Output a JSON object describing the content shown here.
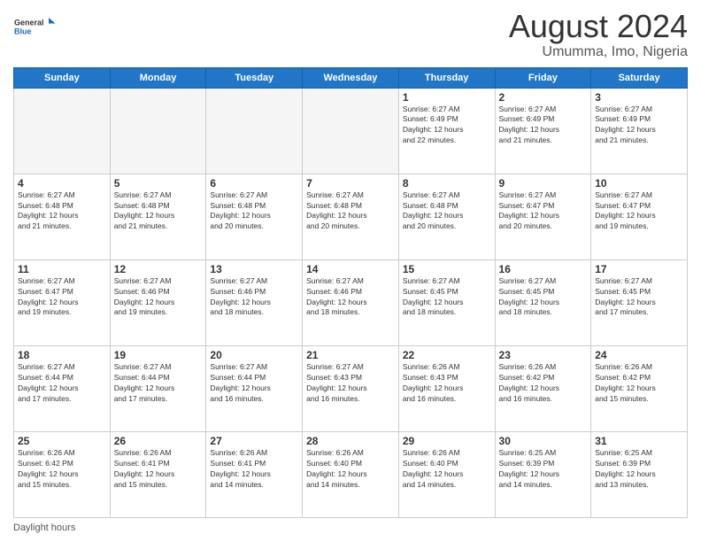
{
  "logo": {
    "line1": "General",
    "line2": "Blue"
  },
  "header": {
    "month_year": "August 2024",
    "location": "Umumma, Imo, Nigeria"
  },
  "days_of_week": [
    "Sunday",
    "Monday",
    "Tuesday",
    "Wednesday",
    "Thursday",
    "Friday",
    "Saturday"
  ],
  "footer": {
    "daylight_label": "Daylight hours"
  },
  "weeks": [
    {
      "days": [
        {
          "num": "",
          "info": ""
        },
        {
          "num": "",
          "info": ""
        },
        {
          "num": "",
          "info": ""
        },
        {
          "num": "",
          "info": ""
        },
        {
          "num": "1",
          "info": "Sunrise: 6:27 AM\nSunset: 6:49 PM\nDaylight: 12 hours\nand 22 minutes."
        },
        {
          "num": "2",
          "info": "Sunrise: 6:27 AM\nSunset: 6:49 PM\nDaylight: 12 hours\nand 21 minutes."
        },
        {
          "num": "3",
          "info": "Sunrise: 6:27 AM\nSunset: 6:49 PM\nDaylight: 12 hours\nand 21 minutes."
        }
      ]
    },
    {
      "days": [
        {
          "num": "4",
          "info": "Sunrise: 6:27 AM\nSunset: 6:48 PM\nDaylight: 12 hours\nand 21 minutes."
        },
        {
          "num": "5",
          "info": "Sunrise: 6:27 AM\nSunset: 6:48 PM\nDaylight: 12 hours\nand 21 minutes."
        },
        {
          "num": "6",
          "info": "Sunrise: 6:27 AM\nSunset: 6:48 PM\nDaylight: 12 hours\nand 20 minutes."
        },
        {
          "num": "7",
          "info": "Sunrise: 6:27 AM\nSunset: 6:48 PM\nDaylight: 12 hours\nand 20 minutes."
        },
        {
          "num": "8",
          "info": "Sunrise: 6:27 AM\nSunset: 6:48 PM\nDaylight: 12 hours\nand 20 minutes."
        },
        {
          "num": "9",
          "info": "Sunrise: 6:27 AM\nSunset: 6:47 PM\nDaylight: 12 hours\nand 20 minutes."
        },
        {
          "num": "10",
          "info": "Sunrise: 6:27 AM\nSunset: 6:47 PM\nDaylight: 12 hours\nand 19 minutes."
        }
      ]
    },
    {
      "days": [
        {
          "num": "11",
          "info": "Sunrise: 6:27 AM\nSunset: 6:47 PM\nDaylight: 12 hours\nand 19 minutes."
        },
        {
          "num": "12",
          "info": "Sunrise: 6:27 AM\nSunset: 6:46 PM\nDaylight: 12 hours\nand 19 minutes."
        },
        {
          "num": "13",
          "info": "Sunrise: 6:27 AM\nSunset: 6:46 PM\nDaylight: 12 hours\nand 18 minutes."
        },
        {
          "num": "14",
          "info": "Sunrise: 6:27 AM\nSunset: 6:46 PM\nDaylight: 12 hours\nand 18 minutes."
        },
        {
          "num": "15",
          "info": "Sunrise: 6:27 AM\nSunset: 6:45 PM\nDaylight: 12 hours\nand 18 minutes."
        },
        {
          "num": "16",
          "info": "Sunrise: 6:27 AM\nSunset: 6:45 PM\nDaylight: 12 hours\nand 18 minutes."
        },
        {
          "num": "17",
          "info": "Sunrise: 6:27 AM\nSunset: 6:45 PM\nDaylight: 12 hours\nand 17 minutes."
        }
      ]
    },
    {
      "days": [
        {
          "num": "18",
          "info": "Sunrise: 6:27 AM\nSunset: 6:44 PM\nDaylight: 12 hours\nand 17 minutes."
        },
        {
          "num": "19",
          "info": "Sunrise: 6:27 AM\nSunset: 6:44 PM\nDaylight: 12 hours\nand 17 minutes."
        },
        {
          "num": "20",
          "info": "Sunrise: 6:27 AM\nSunset: 6:44 PM\nDaylight: 12 hours\nand 16 minutes."
        },
        {
          "num": "21",
          "info": "Sunrise: 6:27 AM\nSunset: 6:43 PM\nDaylight: 12 hours\nand 16 minutes."
        },
        {
          "num": "22",
          "info": "Sunrise: 6:26 AM\nSunset: 6:43 PM\nDaylight: 12 hours\nand 16 minutes."
        },
        {
          "num": "23",
          "info": "Sunrise: 6:26 AM\nSunset: 6:42 PM\nDaylight: 12 hours\nand 16 minutes."
        },
        {
          "num": "24",
          "info": "Sunrise: 6:26 AM\nSunset: 6:42 PM\nDaylight: 12 hours\nand 15 minutes."
        }
      ]
    },
    {
      "days": [
        {
          "num": "25",
          "info": "Sunrise: 6:26 AM\nSunset: 6:42 PM\nDaylight: 12 hours\nand 15 minutes."
        },
        {
          "num": "26",
          "info": "Sunrise: 6:26 AM\nSunset: 6:41 PM\nDaylight: 12 hours\nand 15 minutes."
        },
        {
          "num": "27",
          "info": "Sunrise: 6:26 AM\nSunset: 6:41 PM\nDaylight: 12 hours\nand 14 minutes."
        },
        {
          "num": "28",
          "info": "Sunrise: 6:26 AM\nSunset: 6:40 PM\nDaylight: 12 hours\nand 14 minutes."
        },
        {
          "num": "29",
          "info": "Sunrise: 6:26 AM\nSunset: 6:40 PM\nDaylight: 12 hours\nand 14 minutes."
        },
        {
          "num": "30",
          "info": "Sunrise: 6:25 AM\nSunset: 6:39 PM\nDaylight: 12 hours\nand 14 minutes."
        },
        {
          "num": "31",
          "info": "Sunrise: 6:25 AM\nSunset: 6:39 PM\nDaylight: 12 hours\nand 13 minutes."
        }
      ]
    }
  ]
}
